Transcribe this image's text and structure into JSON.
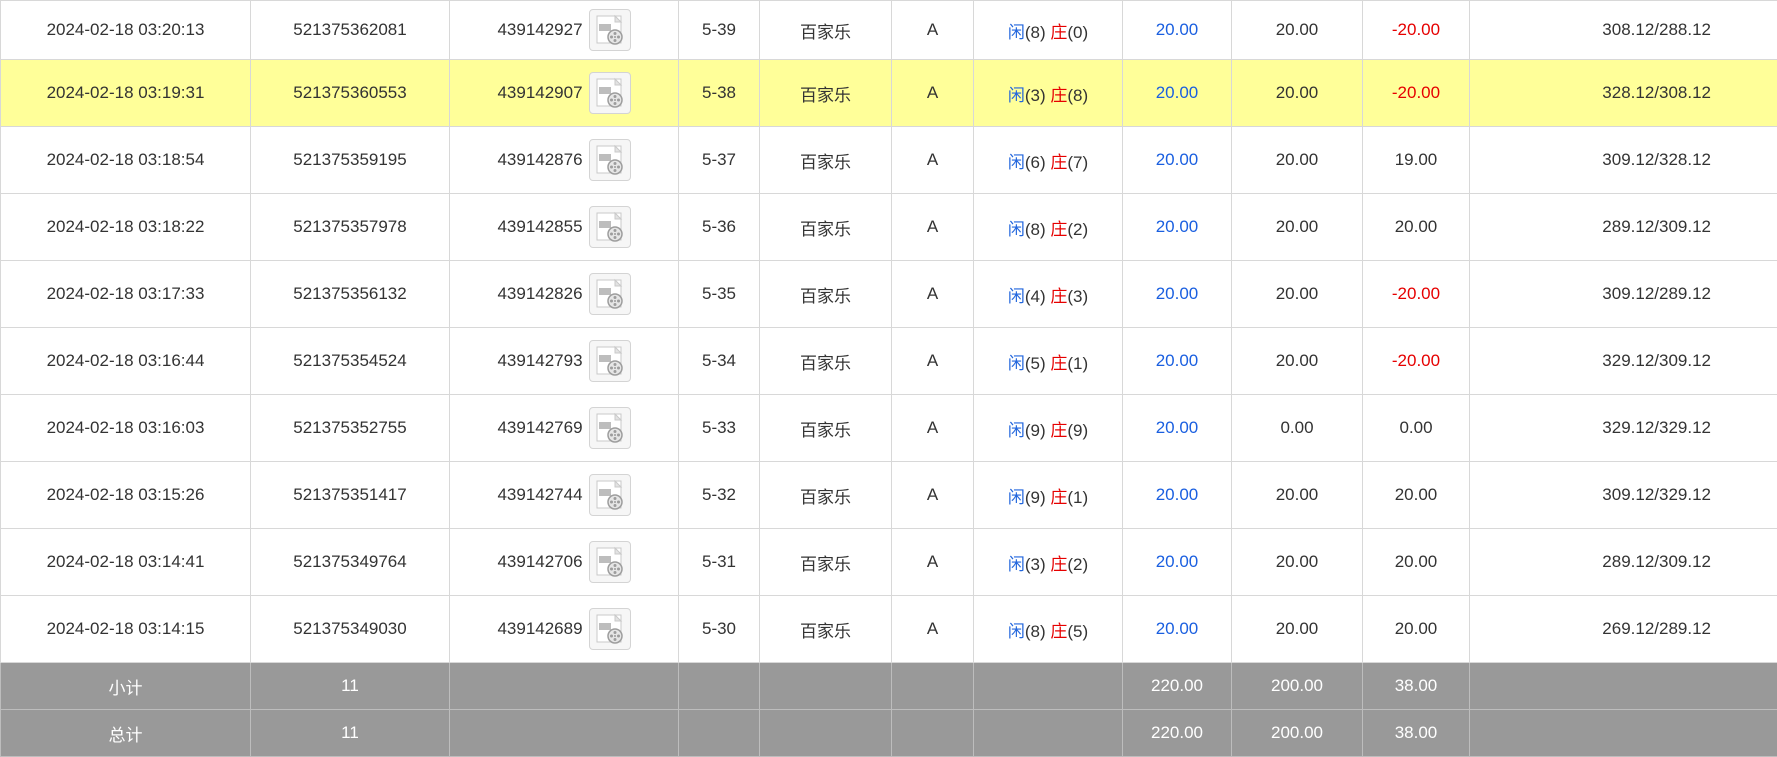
{
  "rows": [
    {
      "time": "2024-02-18 03:20:13",
      "order_id": "521375362081",
      "game_id": "439142927",
      "round": "5-39",
      "game": "百家乐",
      "table": "A",
      "xian_label": "闲",
      "xian_score": "(8)",
      "zhuang_label": "庄",
      "zhuang_score": "(0)",
      "bet": "20.00",
      "valid_bet": "20.00",
      "win_loss": "-20.00",
      "balance": "308.12/288.12"
    },
    {
      "time": "2024-02-18 03:19:31",
      "order_id": "521375360553",
      "game_id": "439142907",
      "round": "5-38",
      "game": "百家乐",
      "table": "A",
      "xian_label": "闲",
      "xian_score": "(3)",
      "zhuang_label": "庄",
      "zhuang_score": "(8)",
      "bet": "20.00",
      "valid_bet": "20.00",
      "win_loss": "-20.00",
      "balance": "328.12/308.12"
    },
    {
      "time": "2024-02-18 03:18:54",
      "order_id": "521375359195",
      "game_id": "439142876",
      "round": "5-37",
      "game": "百家乐",
      "table": "A",
      "xian_label": "闲",
      "xian_score": "(6)",
      "zhuang_label": "庄",
      "zhuang_score": "(7)",
      "bet": "20.00",
      "valid_bet": "20.00",
      "win_loss": "19.00",
      "balance": "309.12/328.12"
    },
    {
      "time": "2024-02-18 03:18:22",
      "order_id": "521375357978",
      "game_id": "439142855",
      "round": "5-36",
      "game": "百家乐",
      "table": "A",
      "xian_label": "闲",
      "xian_score": "(8)",
      "zhuang_label": "庄",
      "zhuang_score": "(2)",
      "bet": "20.00",
      "valid_bet": "20.00",
      "win_loss": "20.00",
      "balance": "289.12/309.12"
    },
    {
      "time": "2024-02-18 03:17:33",
      "order_id": "521375356132",
      "game_id": "439142826",
      "round": "5-35",
      "game": "百家乐",
      "table": "A",
      "xian_label": "闲",
      "xian_score": "(4)",
      "zhuang_label": "庄",
      "zhuang_score": "(3)",
      "bet": "20.00",
      "valid_bet": "20.00",
      "win_loss": "-20.00",
      "balance": "309.12/289.12"
    },
    {
      "time": "2024-02-18 03:16:44",
      "order_id": "521375354524",
      "game_id": "439142793",
      "round": "5-34",
      "game": "百家乐",
      "table": "A",
      "xian_label": "闲",
      "xian_score": "(5)",
      "zhuang_label": "庄",
      "zhuang_score": "(1)",
      "bet": "20.00",
      "valid_bet": "20.00",
      "win_loss": "-20.00",
      "balance": "329.12/309.12"
    },
    {
      "time": "2024-02-18 03:16:03",
      "order_id": "521375352755",
      "game_id": "439142769",
      "round": "5-33",
      "game": "百家乐",
      "table": "A",
      "xian_label": "闲",
      "xian_score": "(9)",
      "zhuang_label": "庄",
      "zhuang_score": "(9)",
      "bet": "20.00",
      "valid_bet": "0.00",
      "win_loss": "0.00",
      "balance": "329.12/329.12"
    },
    {
      "time": "2024-02-18 03:15:26",
      "order_id": "521375351417",
      "game_id": "439142744",
      "round": "5-32",
      "game": "百家乐",
      "table": "A",
      "xian_label": "闲",
      "xian_score": "(9)",
      "zhuang_label": "庄",
      "zhuang_score": "(1)",
      "bet": "20.00",
      "valid_bet": "20.00",
      "win_loss": "20.00",
      "balance": "309.12/329.12"
    },
    {
      "time": "2024-02-18 03:14:41",
      "order_id": "521375349764",
      "game_id": "439142706",
      "round": "5-31",
      "game": "百家乐",
      "table": "A",
      "xian_label": "闲",
      "xian_score": "(3)",
      "zhuang_label": "庄",
      "zhuang_score": "(2)",
      "bet": "20.00",
      "valid_bet": "20.00",
      "win_loss": "20.00",
      "balance": "289.12/309.12"
    },
    {
      "time": "2024-02-18 03:14:15",
      "order_id": "521375349030",
      "game_id": "439142689",
      "round": "5-30",
      "game": "百家乐",
      "table": "A",
      "xian_label": "闲",
      "xian_score": "(8)",
      "zhuang_label": "庄",
      "zhuang_score": "(5)",
      "bet": "20.00",
      "valid_bet": "20.00",
      "win_loss": "20.00",
      "balance": "269.12/289.12"
    }
  ],
  "subtotal": {
    "label": "小计",
    "count": "11",
    "bet": "220.00",
    "valid_bet": "200.00",
    "win_loss": "38.00"
  },
  "total": {
    "label": "总计",
    "count": "11",
    "bet": "220.00",
    "valid_bet": "200.00",
    "win_loss": "38.00"
  },
  "highlight_row_index": 1,
  "colors": {
    "highlight": "#ffff99",
    "xian": "#2266dd",
    "zhuang": "#e60000",
    "negative": "#e60000",
    "bet_blue": "#1a5fe0",
    "summary_bg": "#999999"
  },
  "icons": {
    "game_video": "film-reel-icon"
  }
}
